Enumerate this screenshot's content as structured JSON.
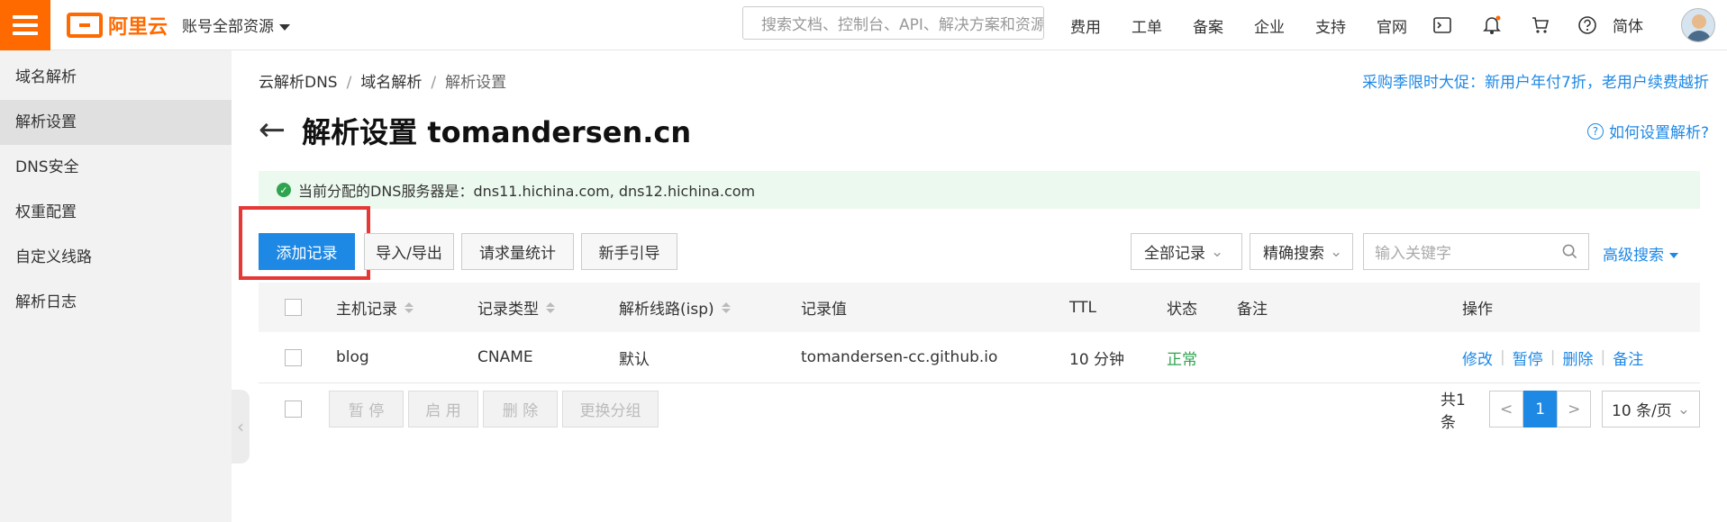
{
  "topbar": {
    "logo_text": "阿里云",
    "account_label": "账号全部资源",
    "search_placeholder": "搜索文档、控制台、API、解决方案和资源",
    "nav": [
      "费用",
      "工单",
      "备案",
      "企业",
      "支持",
      "官网"
    ],
    "language": "简体",
    "icons": [
      "terminal-icon",
      "bell-icon",
      "cart-icon",
      "help-circle-icon"
    ]
  },
  "sidebar": {
    "items": [
      {
        "label": "域名解析",
        "active": false
      },
      {
        "label": "解析设置",
        "active": true
      },
      {
        "label": "DNS安全",
        "active": false
      },
      {
        "label": "权重配置",
        "active": false
      },
      {
        "label": "自定义线路",
        "active": false
      },
      {
        "label": "解析日志",
        "active": false
      }
    ]
  },
  "breadcrumb": {
    "items": [
      "云解析DNS",
      "域名解析",
      "解析设置"
    ],
    "separator": "/"
  },
  "promo": "采购季限时大促：新用户年付7折，老用户续费越折",
  "page": {
    "title": "解析设置 tomandersen.cn",
    "help_link": "如何设置解析?"
  },
  "notice": {
    "text": "当前分配的DNS服务器是：dns11.hichina.com, dns12.hichina.com"
  },
  "toolbar": {
    "add_record": "添加记录",
    "import_export": "导入/导出",
    "request_stats": "请求量统计",
    "guide": "新手引导",
    "all_records": "全部记录",
    "precise_search": "精确搜索",
    "keyword_placeholder": "输入关键字",
    "advanced_search": "高级搜索"
  },
  "table": {
    "headers": {
      "host": "主机记录",
      "type": "记录类型",
      "line": "解析线路(isp)",
      "value": "记录值",
      "ttl": "TTL",
      "status": "状态",
      "remark": "备注",
      "actions": "操作"
    },
    "rows": [
      {
        "host": "blog",
        "type": "CNAME",
        "line": "默认",
        "value": "tomandersen-cc.github.io",
        "ttl": "10 分钟",
        "status": "正常",
        "remark": "",
        "actions": [
          "修改",
          "暂停",
          "删除",
          "备注"
        ]
      }
    ]
  },
  "bulk": {
    "pause": "暂 停",
    "enable": "启 用",
    "delete": "删 除",
    "change_group": "更换分组"
  },
  "pagination": {
    "total": "共1条",
    "prev": "<",
    "current": "1",
    "next": ">",
    "page_size": "10 条/页"
  },
  "colors": {
    "brand": "#ff6a00",
    "primary": "#1e88e5",
    "success": "#2ea44f",
    "highlight": "#e53935"
  }
}
